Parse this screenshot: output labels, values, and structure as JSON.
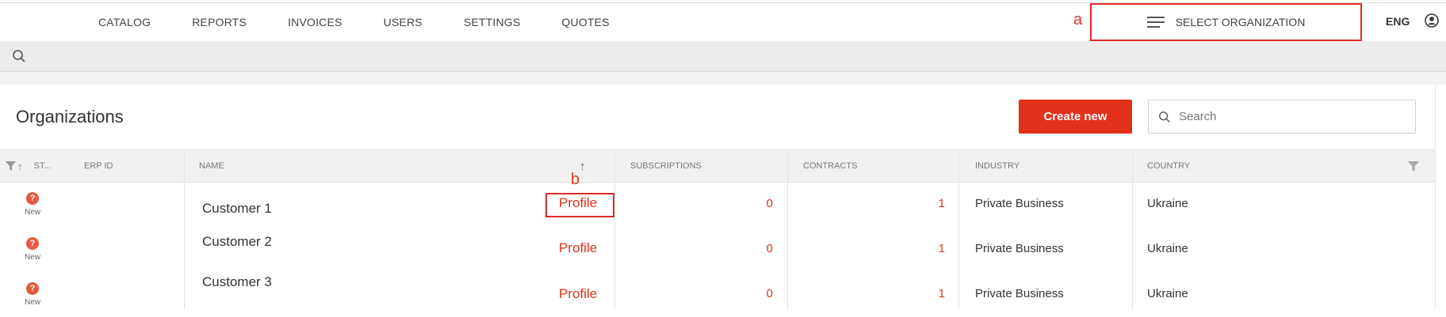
{
  "nav": {
    "items": [
      "CATALOG",
      "REPORTS",
      "INVOICES",
      "USERS",
      "SETTINGS",
      "QUOTES"
    ],
    "select_org_label": "SELECT ORGANIZATION",
    "language": "ENG"
  },
  "annotations": {
    "a": "a",
    "b": "b"
  },
  "page": {
    "title": "Organizations",
    "create_button": "Create new",
    "search_placeholder": "Search"
  },
  "table": {
    "columns": {
      "status": "ST...",
      "erp_id": "ERP ID",
      "name": "NAME",
      "subscriptions": "SUBSCRIPTIONS",
      "contracts": "CONTRACTS",
      "industry": "INDUSTRY",
      "country": "COUNTRY"
    },
    "sort_indicator": "↑",
    "rows": [
      {
        "status": "New",
        "erp_id": "",
        "name": "Customer 1",
        "profile": "Profile",
        "subscriptions": "0",
        "contracts": "1",
        "industry": "Private Business",
        "country": "Ukraine"
      },
      {
        "status": "New",
        "erp_id": "",
        "name": "Customer 2",
        "profile": "Profile",
        "subscriptions": "0",
        "contracts": "1",
        "industry": "Private Business",
        "country": "Ukraine"
      },
      {
        "status": "New",
        "erp_id": "",
        "name": "Customer 3",
        "profile": "Profile",
        "subscriptions": "0",
        "contracts": "1",
        "industry": "Private Business",
        "country": "Ukraine"
      }
    ]
  },
  "colors": {
    "accent": "#e2311b",
    "highlight_box": "#e02a2a",
    "status_dot": "#e65a40"
  }
}
